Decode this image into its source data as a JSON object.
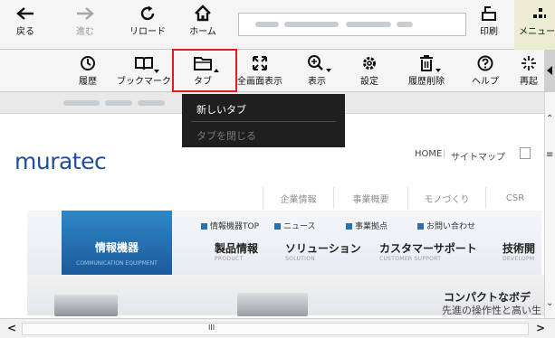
{
  "toolbar_top": {
    "back": "戻る",
    "forward": "進む",
    "reload": "リロード",
    "home": "ホーム",
    "print": "印刷",
    "menu": "メニュー"
  },
  "toolbar_bottom": {
    "history": "履歴",
    "bookmark": "ブックマーク",
    "tab": "タブ",
    "fullscreen": "全画面表示",
    "view": "表示",
    "settings": "設定",
    "history_delete": "履歴削除",
    "help": "ヘルプ",
    "replay": "再起"
  },
  "tab_menu": {
    "new_tab": "新しいタブ",
    "close_tab": "タブを閉じる"
  },
  "page": {
    "logo": "muratec",
    "header_links": [
      "HOME",
      "サイトマップ"
    ],
    "nav_tabs": [
      "企業情報",
      "事業概要",
      "モノづくり",
      "CSR"
    ],
    "banner_title": "情報機器",
    "banner_sub": "COMMUNICATION EQUIPMENT",
    "sub_links": [
      "情報機器TOP",
      "ニュース",
      "事業拠点",
      "お問い合わせ"
    ],
    "main_nav": [
      {
        "label": "製品情報",
        "sub": "PRODUCT"
      },
      {
        "label": "ソリューション",
        "sub": "SOLUTION"
      },
      {
        "label": "カスタマーサポート",
        "sub": "CUSTOMER SUPPORT"
      },
      {
        "label": "技術開",
        "sub": "DEVELOPM"
      }
    ],
    "promo_line1": "コンパクトなボデ",
    "promo_line2": "先進の操作性と高い生"
  },
  "scrollbar": {
    "left_arrow": "<",
    "right_arrow": ">",
    "thumb": "III"
  },
  "colors": {
    "highlight": "#e21b1b",
    "logo": "#1f4f9a",
    "menu_bg": "#1f1f1f",
    "accent_blue": "#2a6fb8"
  }
}
